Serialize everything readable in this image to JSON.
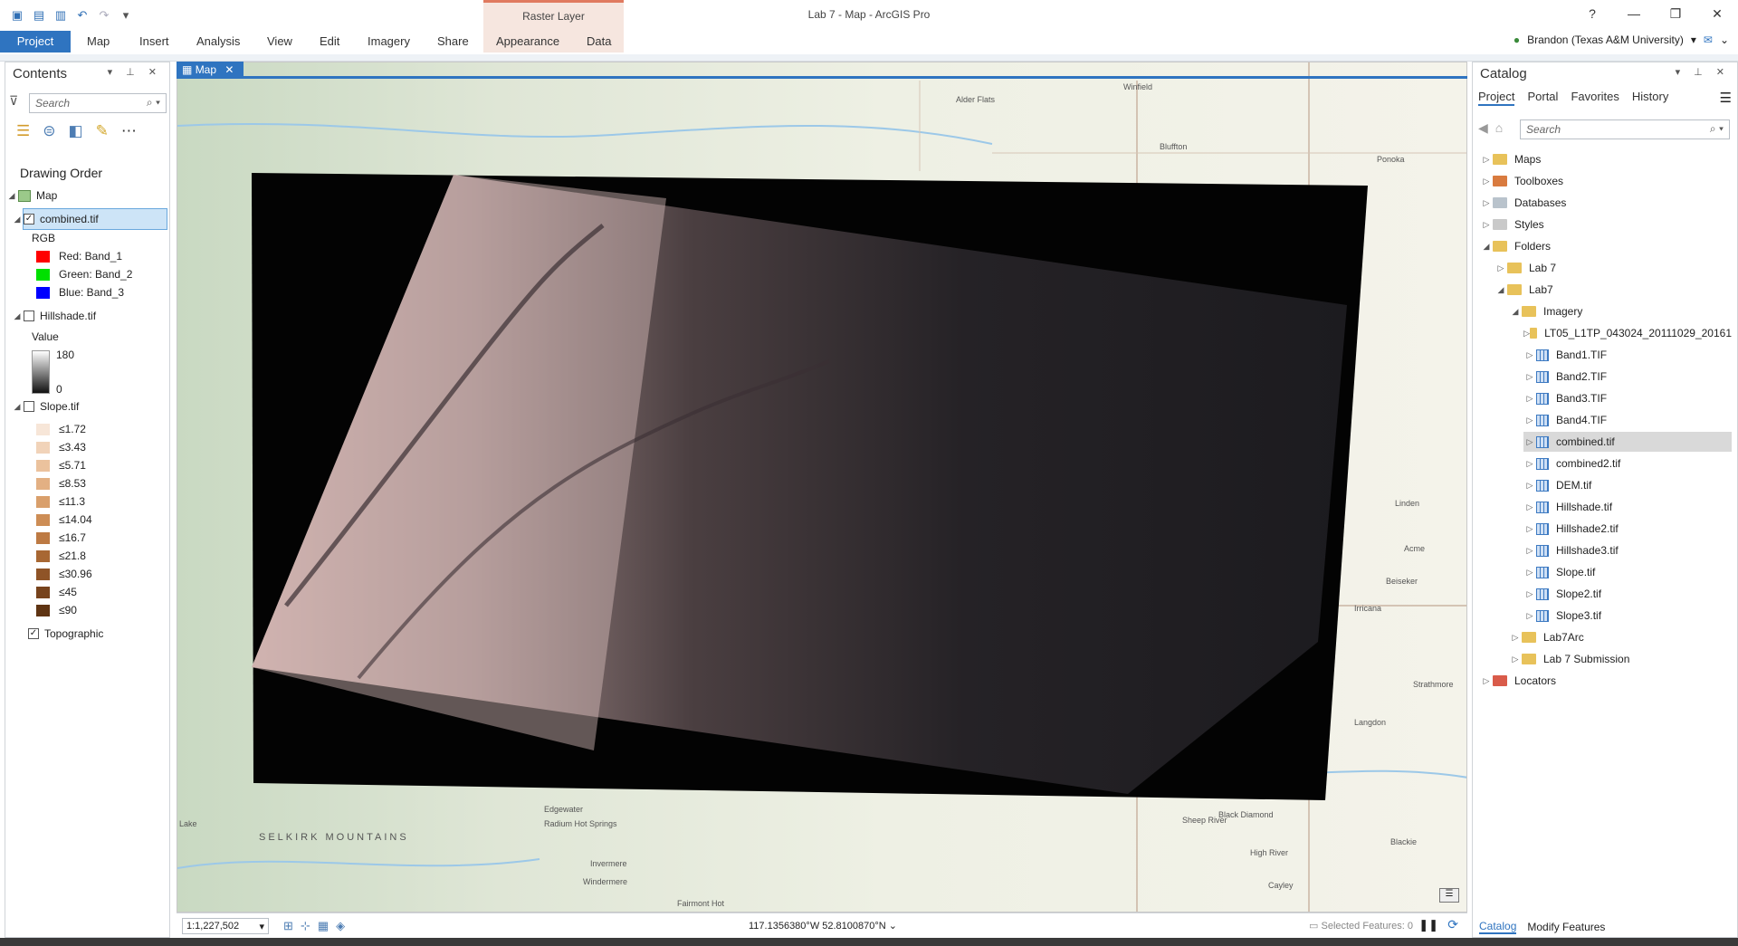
{
  "window": {
    "title": "Lab 7 - Map - ArcGIS Pro",
    "contextual_group": "Raster Layer"
  },
  "ribbon": {
    "tabs": [
      "Project",
      "Map",
      "Insert",
      "Analysis",
      "View",
      "Edit",
      "Imagery",
      "Share",
      "Appearance",
      "Data"
    ],
    "user": "Brandon (Texas A&M University)"
  },
  "contents": {
    "title": "Contents",
    "search_placeholder": "Search",
    "drawing_order": "Drawing Order",
    "map_label": "Map",
    "layer_combined": "combined.tif",
    "rgb_label": "RGB",
    "red": "Red:  Band_1",
    "green": "Green: Band_2",
    "blue": "Blue:  Band_3",
    "layer_hillshade": "Hillshade.tif",
    "value_label": "Value",
    "value_high": "180",
    "value_low": "0",
    "layer_slope": "Slope.tif",
    "slope_classes": [
      "≤1.72",
      "≤3.43",
      "≤5.71",
      "≤8.53",
      "≤11.3",
      "≤14.04",
      "≤16.7",
      "≤21.8",
      "≤30.96",
      "≤45",
      "≤90"
    ],
    "slope_colors": [
      "#f7e6d8",
      "#f1d3b9",
      "#ebc29d",
      "#e3b083",
      "#d99f6b",
      "#cd8d55",
      "#bd7a43",
      "#a86733",
      "#8f5427",
      "#77431c",
      "#5f3413"
    ],
    "layer_topo": "Topographic"
  },
  "map": {
    "tab": "Map",
    "scale": "1:1,227,502",
    "coords": "117.1356380°W 52.8100870°N",
    "selected": "Selected Features: 0",
    "labels": [
      {
        "t": "Alder Flats"
      },
      {
        "t": "Winfield"
      },
      {
        "t": "Bluffton"
      },
      {
        "t": "Ponoka"
      },
      {
        "t": "Linden"
      },
      {
        "t": "Acme"
      },
      {
        "t": "Beiseker"
      },
      {
        "t": "Irricana"
      },
      {
        "t": "Strathmore"
      },
      {
        "t": "Langdon"
      },
      {
        "t": "Black Diamond"
      },
      {
        "t": "High River"
      },
      {
        "t": "Blackie"
      },
      {
        "t": "Cayley"
      },
      {
        "t": "Edgewater"
      },
      {
        "t": "Radium Hot Springs"
      },
      {
        "t": "Invermere"
      },
      {
        "t": "Windermere"
      },
      {
        "t": "Fairmont Hot"
      },
      {
        "t": "SELKIRK MOUNTAINS"
      },
      {
        "t": "Lake"
      },
      {
        "t": "Sheep River"
      }
    ]
  },
  "catalog": {
    "title": "Catalog",
    "tabs": [
      "Project",
      "Portal",
      "Favorites",
      "History"
    ],
    "search_placeholder": "Search",
    "items": [
      {
        "label": "Maps"
      },
      {
        "label": "Toolboxes"
      },
      {
        "label": "Databases"
      },
      {
        "label": "Styles"
      },
      {
        "label": "Folders"
      },
      {
        "label": "Lab 7"
      },
      {
        "label": "Lab7"
      },
      {
        "label": "Imagery"
      },
      {
        "label": "LT05_L1TP_043024_20111029_20161"
      },
      {
        "label": "Band1.TIF"
      },
      {
        "label": "Band2.TIF"
      },
      {
        "label": "Band3.TIF"
      },
      {
        "label": "Band4.TIF"
      },
      {
        "label": "combined.tif"
      },
      {
        "label": "combined2.tif"
      },
      {
        "label": "DEM.tif"
      },
      {
        "label": "Hillshade.tif"
      },
      {
        "label": "Hillshade2.tif"
      },
      {
        "label": "Hillshade3.tif"
      },
      {
        "label": "Slope.tif"
      },
      {
        "label": "Slope2.tif"
      },
      {
        "label": "Slope3.tif"
      },
      {
        "label": "Lab7Arc"
      },
      {
        "label": "Lab 7 Submission"
      },
      {
        "label": "Locators"
      }
    ],
    "bottom_tabs": [
      "Catalog",
      "Modify Features"
    ]
  }
}
